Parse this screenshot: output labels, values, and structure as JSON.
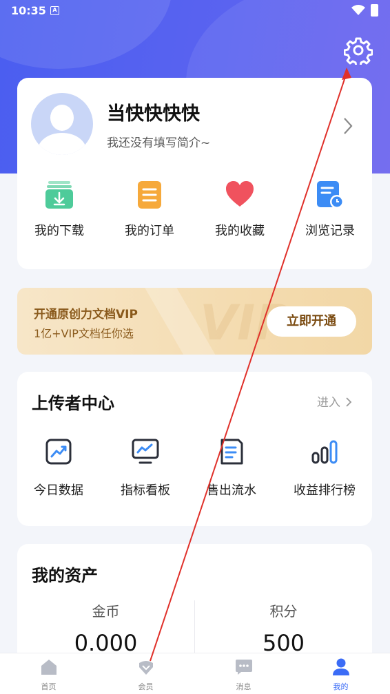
{
  "status_bar": {
    "time": "10:35",
    "sim_label": "A"
  },
  "profile": {
    "name": "当快快快快",
    "bio": "我还没有填写简介~"
  },
  "quick_actions": [
    {
      "label": "我的下载",
      "icon": "download-icon",
      "color": "#4ecb9a"
    },
    {
      "label": "我的订单",
      "icon": "order-icon",
      "color": "#f6a93b"
    },
    {
      "label": "我的收藏",
      "icon": "heart-icon",
      "color": "#f0525e"
    },
    {
      "label": "浏览记录",
      "icon": "history-icon",
      "color": "#3c8cf5"
    }
  ],
  "vip_banner": {
    "title": "开通原创力文档VIP",
    "subtitle": "1亿+VIP文档任你选",
    "button": "立即开通",
    "watermark": "VIP"
  },
  "uploader_center": {
    "title": "上传者中心",
    "enter": "进入",
    "tools": [
      {
        "label": "今日数据",
        "icon": "trend-chart-icon"
      },
      {
        "label": "指标看板",
        "icon": "monitor-chart-icon"
      },
      {
        "label": "售出流水",
        "icon": "receipt-icon"
      },
      {
        "label": "收益排行榜",
        "icon": "bar-ranking-icon"
      }
    ]
  },
  "assets": {
    "title": "我的资产",
    "items": [
      {
        "label": "金币",
        "value": "0.000"
      },
      {
        "label": "积分",
        "value": "500"
      }
    ]
  },
  "tabbar": {
    "items": [
      {
        "label": "首页",
        "icon": "home-icon",
        "active": false
      },
      {
        "label": "会员",
        "icon": "vip-diamond-icon",
        "active": false
      },
      {
        "label": "消息",
        "icon": "message-icon",
        "active": false
      },
      {
        "label": "我的",
        "icon": "user-icon",
        "active": true
      }
    ]
  },
  "colors": {
    "header_gradient_start": "#4a5ef0",
    "accent_blue": "#3b6cf6",
    "vip_gold": "#8a5a1c",
    "annotation_arrow": "#e0302a"
  }
}
